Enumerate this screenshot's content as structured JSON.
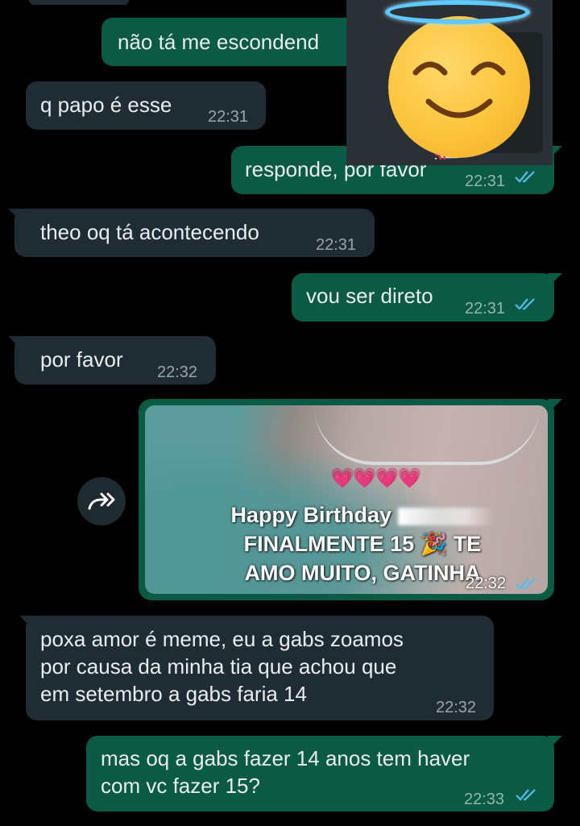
{
  "messages": [
    {
      "id": "m1",
      "dir": "out",
      "text": "não tá me escondend",
      "time": "",
      "read": false
    },
    {
      "id": "m2",
      "dir": "in",
      "text": "q papo é esse",
      "time": "22:31"
    },
    {
      "id": "m3",
      "dir": "out",
      "text": "responde, por favor",
      "time": "22:31",
      "read": true
    },
    {
      "id": "m4",
      "dir": "in",
      "text": "theo oq tá acontecendo",
      "time": "22:31"
    },
    {
      "id": "m5",
      "dir": "out",
      "text": "vou ser direto",
      "time": "22:31",
      "read": true
    },
    {
      "id": "m6",
      "dir": "in",
      "text": "por favor",
      "time": "22:32"
    },
    {
      "id": "m7",
      "dir": "out",
      "type": "image",
      "time": "22:32",
      "read": true,
      "image_text": {
        "hearts": "💗💗💗💗",
        "line1": "Happy Birthday",
        "line2": "FINALMENTE 15 🎉 TE",
        "line3": "AMO MUITO, GATINHA"
      }
    },
    {
      "id": "m8",
      "dir": "in",
      "text": "poxa amor é meme, eu a gabs zoamos\npor causa da minha tia que achou que\nem setembro a gabs faria 14",
      "time": "22:32"
    },
    {
      "id": "m9",
      "dir": "out",
      "text": "mas oq a gabs fazer 14 anos tem haver\ncom vc fazer 15?",
      "time": "22:33",
      "read": true
    }
  ],
  "colors": {
    "incoming": "#1f2c33",
    "outgoing": "#0b5a44",
    "read_ticks": "#53bdeb",
    "halo": "#5ec8ff"
  },
  "icons": {
    "forward": "forward-icon",
    "ticks": "double-check-icon",
    "cast": "cast-icon",
    "emoji": "smiling-face-with-halo-emoji"
  }
}
